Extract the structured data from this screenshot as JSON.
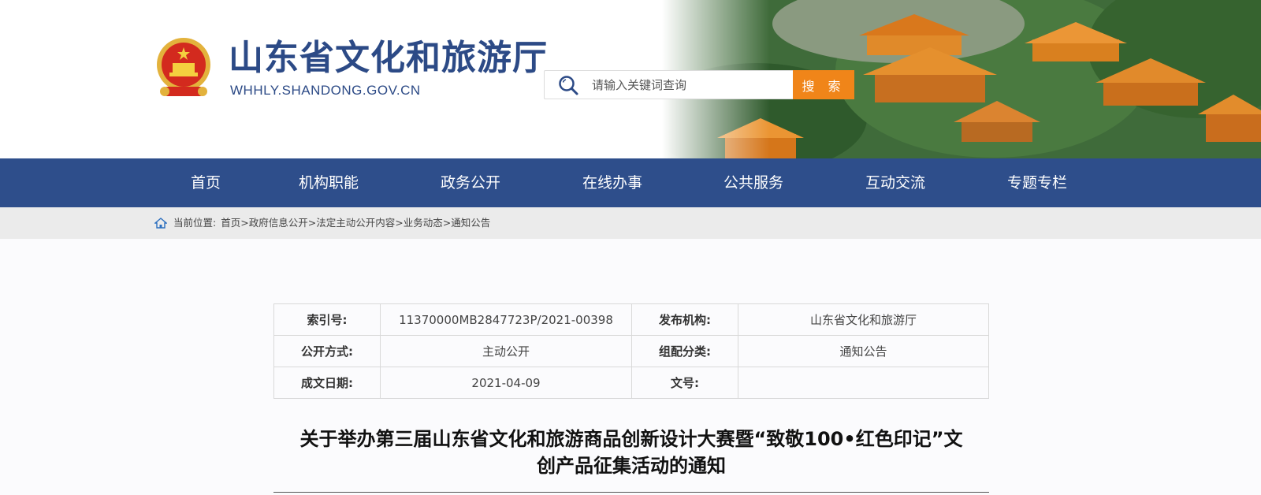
{
  "header": {
    "site_title": "山东省文化和旅游厅",
    "site_domain": "WHHLY.SHANDONG.GOV.CN",
    "search_placeholder": "请输入关键词查询",
    "search_button": "搜 索",
    "colors": {
      "title": "#2c4a86",
      "search_button": "#f08519"
    }
  },
  "nav": {
    "items": [
      "首页",
      "机构职能",
      "政务公开",
      "在线办事",
      "公共服务",
      "互动交流",
      "专题专栏"
    ],
    "color": "#2e4e8b"
  },
  "breadcrumb": {
    "prefix": "当前位置:",
    "items": [
      "首页",
      "政府信息公开",
      "法定主动公开内容",
      "业务动态",
      "通知公告"
    ]
  },
  "meta": {
    "rows": [
      {
        "k1": "索引号:",
        "v1": "11370000MB2847723P/2021-00398",
        "k2": "发布机构:",
        "v2": "山东省文化和旅游厅"
      },
      {
        "k1": "公开方式:",
        "v1": "主动公开",
        "k2": "组配分类:",
        "v2": "通知公告"
      },
      {
        "k1": "成文日期:",
        "v1": "2021-04-09",
        "k2": "文号:",
        "v2": ""
      }
    ]
  },
  "article": {
    "title_line1": "关于举办第三届山东省文化和旅游商品创新设计大赛暨“致敬100•红色印记”文",
    "title_line2": "创产品征集活动的通知"
  }
}
